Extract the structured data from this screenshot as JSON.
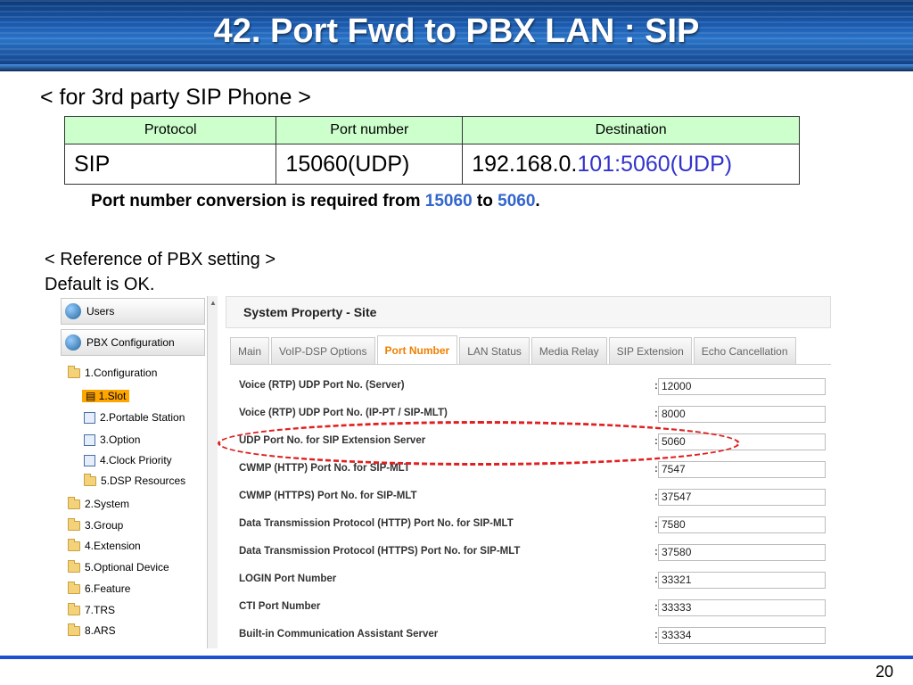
{
  "header": {
    "title": "42. Port Fwd to PBX LAN : SIP"
  },
  "subtitle": "< for 3rd party SIP Phone >",
  "port_table": {
    "headers": [
      "Protocol",
      "Port number",
      "Destination"
    ],
    "row": {
      "protocol": "SIP",
      "port": "15060(UDP)",
      "dest_prefix": "192.168.0.",
      "dest_suffix": "101:5060(UDP)"
    }
  },
  "note": {
    "prefix": "Port number conversion is required from ",
    "from": "15060",
    "mid": " to ",
    "to": "5060",
    "suffix": "."
  },
  "reference": {
    "line1": "< Reference of PBX setting >",
    "line2": "Default is OK."
  },
  "sidebar": {
    "users": "Users",
    "pbx_config": "PBX Configuration",
    "items": [
      "1.Configuration",
      "1.Slot",
      "2.Portable Station",
      "3.Option",
      "4.Clock Priority",
      "5.DSP Resources",
      "2.System",
      "3.Group",
      "4.Extension",
      "5.Optional Device",
      "6.Feature",
      "7.TRS",
      "8.ARS"
    ]
  },
  "panel": {
    "title": "System Property - Site",
    "tabs": [
      "Main",
      "VoIP-DSP Options",
      "Port Number",
      "LAN Status",
      "Media Relay",
      "SIP Extension",
      "Echo Cancellation"
    ],
    "active_tab": "Port Number",
    "fields": [
      {
        "label": "Voice (RTP) UDP Port No. (Server)",
        "value": "12000"
      },
      {
        "label": "Voice (RTP) UDP Port No. (IP-PT / SIP-MLT)",
        "value": "8000"
      },
      {
        "label": "UDP Port No. for SIP Extension Server",
        "value": "5060"
      },
      {
        "label": "CWMP (HTTP) Port No. for SIP-MLT",
        "value": "7547"
      },
      {
        "label": "CWMP (HTTPS) Port No. for SIP-MLT",
        "value": "37547"
      },
      {
        "label": "Data Transmission Protocol (HTTP) Port No. for SIP-MLT",
        "value": "7580"
      },
      {
        "label": "Data Transmission Protocol (HTTPS) Port No. for SIP-MLT",
        "value": "37580"
      },
      {
        "label": "LOGIN Port Number",
        "value": "33321"
      },
      {
        "label": "CTI Port Number",
        "value": "33333"
      },
      {
        "label": "Built-in Communication Assistant Server",
        "value": "33334"
      }
    ]
  },
  "page_number": "20",
  "colors": {
    "accent_blue": "#3366cc",
    "active_tab": "#f08000",
    "highlight": "#e02020",
    "table_header": "#ccffcc"
  }
}
